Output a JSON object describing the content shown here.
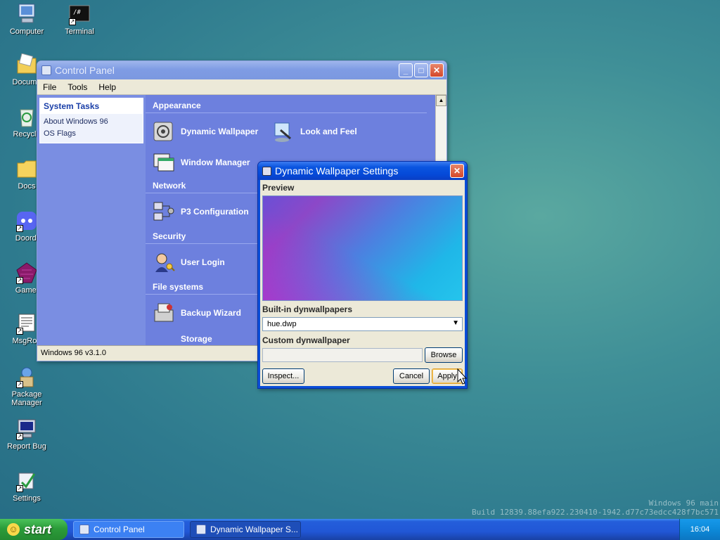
{
  "desktop": {
    "icons": [
      {
        "label": "Computer",
        "icon": "computer-icon"
      },
      {
        "label": "Terminal",
        "icon": "terminal-icon"
      },
      {
        "label": "Docume",
        "icon": "documents-icon"
      },
      {
        "label": "Recycle",
        "icon": "recycle-bin-icon"
      },
      {
        "label": "Docs",
        "icon": "folder-icon"
      },
      {
        "label": "Doordi",
        "icon": "discord-icon"
      },
      {
        "label": "Gamei",
        "icon": "gameicon-icon"
      },
      {
        "label": "MsgRoo",
        "icon": "msgroom-icon"
      },
      {
        "label": "Package Manager",
        "icon": "package-manager-icon"
      },
      {
        "label": "Report Bug",
        "icon": "report-bug-icon"
      },
      {
        "label": "Settings",
        "icon": "settings-icon"
      }
    ],
    "watermark_line1": "Windows 96 main",
    "watermark_line2": "Build 12839.88efa922.230410-1942.d77c73edcc428f7bc571"
  },
  "control_panel": {
    "title": "Control Panel",
    "menu": [
      "File",
      "Tools",
      "Help"
    ],
    "tasks_header": "System Tasks",
    "tasks": [
      "About Windows 96",
      "OS Flags"
    ],
    "sections": {
      "appearance": "Appearance",
      "network": "Network",
      "security": "Security",
      "file_systems": "File systems"
    },
    "items": {
      "dynamic_wallpaper": "Dynamic Wallpaper",
      "look_and_feel": "Look and Feel",
      "window_manager": "Window Manager",
      "p3_configuration": "P3 Configuration",
      "user_login": "User Login",
      "backup_wizard": "Backup Wizard",
      "storage": "Storage"
    },
    "status": "Windows 96 v3.1.0"
  },
  "dialog": {
    "title": "Dynamic Wallpaper Settings",
    "preview_label": "Preview",
    "builtin_label": "Built-in dynwallpapers",
    "builtin_value": "hue.dwp",
    "custom_label": "Custom dynwallpaper",
    "custom_value": "",
    "browse": "Browse",
    "inspect": "Inspect...",
    "cancel": "Cancel",
    "apply": "Apply"
  },
  "taskbar": {
    "start": "start",
    "tasks": [
      "Control Panel",
      "Dynamic Wallpaper S..."
    ],
    "clock": "16:04"
  },
  "colors": {
    "titlebar_active": "#0549d8",
    "panel_bg": "#6d80de",
    "taskbar": "#2157d6",
    "start_green": "#2c9c3a"
  }
}
